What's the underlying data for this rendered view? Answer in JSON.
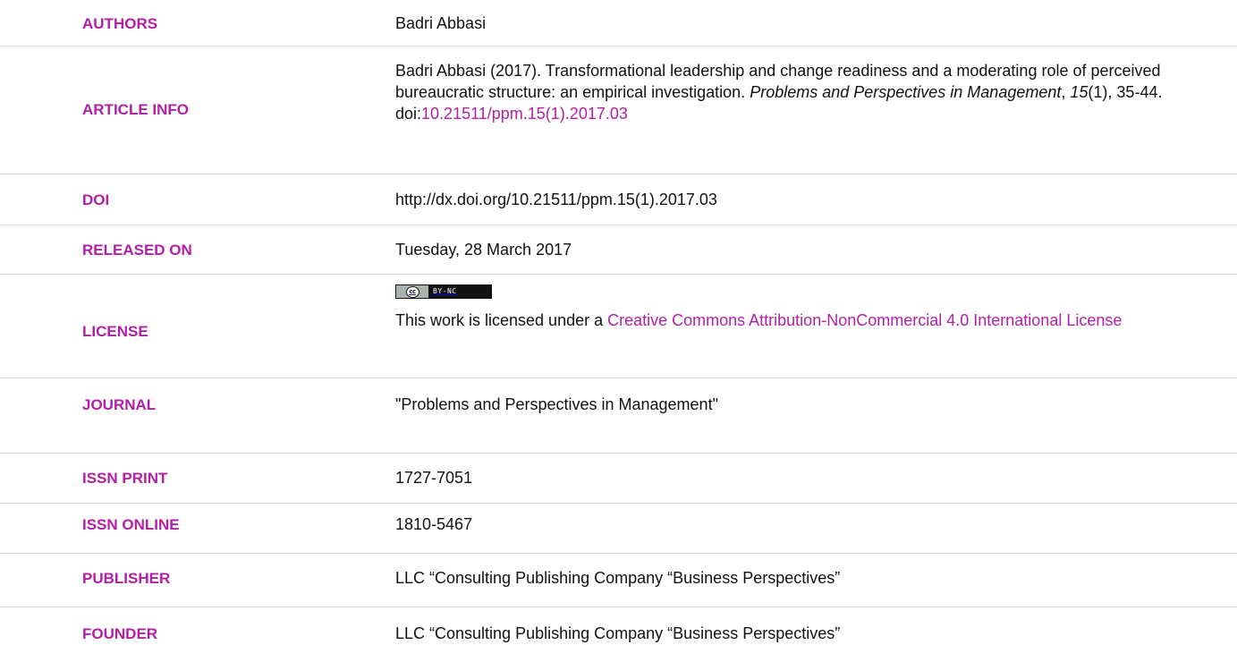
{
  "rows": {
    "authors": {
      "label": "AUTHORS",
      "value": "Badri Abbasi"
    },
    "article_info": {
      "label": "ARTICLE INFO",
      "citation_prefix": "Badri Abbasi (2017). Transformational leadership and change readiness and a moderating role of perceived bureaucratic structure: an empirical investigation. ",
      "journal_italic": "Problems and Perspectives in Management",
      "comma": ", ",
      "volume_italic": "15",
      "issue_pages": "(1), 35-44.",
      "doi_prefix": "doi:",
      "doi_link": "10.21511/ppm.15(1).2017.03"
    },
    "doi": {
      "label": "DOI",
      "value": "http://dx.doi.org/10.21511/ppm.15(1).2017.03"
    },
    "released_on": {
      "label": "RELEASED ON",
      "value": "Tuesday, 28 March 2017"
    },
    "license": {
      "label": "LICENSE",
      "badge_left": "cc",
      "badge_right": "BY-NC",
      "text_prefix": "This work is licensed under a ",
      "link_text": "Creative Commons Attribution-NonCommercial 4.0 International License"
    },
    "journal": {
      "label": "JOURNAL",
      "value": "\"Problems and Perspectives in Management\""
    },
    "issn_print": {
      "label": "ISSN PRINT",
      "value": "1727-7051"
    },
    "issn_online": {
      "label": "ISSN ONLINE",
      "value": "1810-5467"
    },
    "publisher": {
      "label": "PUBLISHER",
      "value": "LLC “Consulting Publishing Company “Business Perspectives”"
    },
    "founder": {
      "label": "FOUNDER",
      "value": "LLC “Consulting Publishing Company “Business Perspectives”"
    }
  },
  "colors": {
    "accent": "#b21fa6",
    "text": "#111111",
    "divider": "#dcdcdc"
  }
}
